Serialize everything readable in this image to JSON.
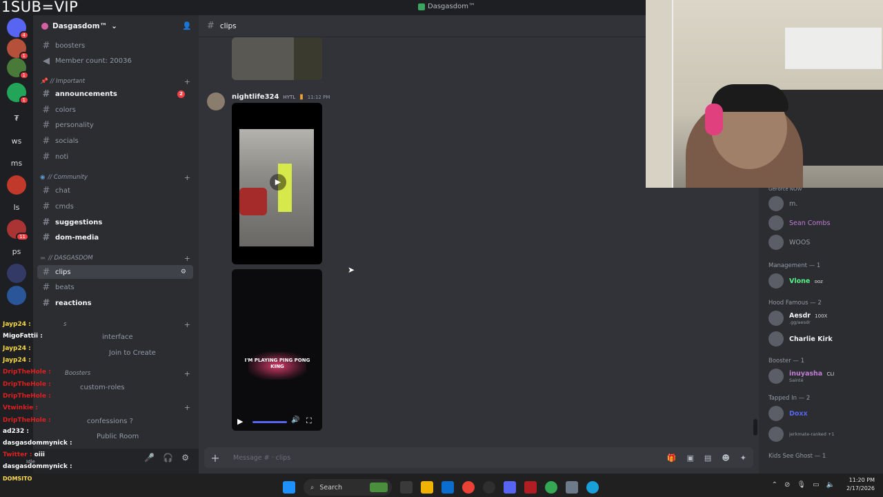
{
  "overlay_banner": "1SUB=VIP",
  "window": {
    "title": "Dasgasdom™"
  },
  "rail": {
    "items": [
      {
        "label": "",
        "badge": "4",
        "color": "#5865f2"
      },
      {
        "label": "",
        "badge": "1",
        "color": "#b5513a"
      },
      {
        "label": "",
        "badge": "1",
        "color": "#4a7a3a"
      },
      {
        "label": "",
        "badge": "1",
        "color": "#23a559"
      },
      {
        "label": "₮",
        "badge": "",
        "color": "#1e1f22"
      },
      {
        "label": "ws",
        "badge": "",
        "color": "#1e1f22"
      },
      {
        "label": "ms",
        "badge": "",
        "color": "#1e1f22"
      },
      {
        "label": "",
        "badge": "",
        "color": "#c0392b"
      },
      {
        "label": "ls",
        "badge": "",
        "color": "#1e1f22"
      },
      {
        "label": "",
        "badge": "11",
        "color": "#a33"
      },
      {
        "label": "ps",
        "badge": "",
        "color": "#1e1f22"
      },
      {
        "label": "",
        "badge": "",
        "color": "#333a66"
      },
      {
        "label": "",
        "badge": "",
        "color": "#2a5599"
      }
    ]
  },
  "guild": {
    "name": "Dasgasdom™"
  },
  "channels": {
    "top": [
      {
        "name": "boosters",
        "icon": "#"
      },
      {
        "name": "Member count: 20036",
        "icon": "🔊"
      }
    ],
    "cat_important": "// Important",
    "important": [
      {
        "name": "announcements",
        "bold": true,
        "badge": "2"
      },
      {
        "name": "colors"
      },
      {
        "name": "personality"
      },
      {
        "name": "socials"
      },
      {
        "name": "noti"
      }
    ],
    "cat_community": "// Community",
    "community": [
      {
        "name": "chat"
      },
      {
        "name": "cmds"
      },
      {
        "name": "suggestions",
        "bold": true
      },
      {
        "name": "dom-media",
        "bold": true
      }
    ],
    "cat_dasgasdom": "// DASGASDOM",
    "dasgasdom": [
      {
        "name": "clips",
        "active": true
      },
      {
        "name": "beats"
      },
      {
        "name": "reactions",
        "bold": true
      }
    ],
    "cat_voice": "s",
    "voice": [
      "interface",
      "Join to Create"
    ],
    "cat_boosters": "Boosters",
    "boosters": [
      "custom-roles"
    ],
    "other": [
      "confessions ?",
      "Public Room"
    ]
  },
  "overlay_chat": [
    {
      "user": "Jayp24",
      "msg": "",
      "color": "#f5d742"
    },
    {
      "user": "MigoFattii",
      "msg": "",
      "color": "#ffffff"
    },
    {
      "user": "Jayp24",
      "msg": "",
      "color": "#f5d742"
    },
    {
      "user": "Jayp24",
      "msg": "",
      "color": "#f5d742"
    },
    {
      "user": "DripTheHole",
      "msg": "",
      "color": "#e02020"
    },
    {
      "user": "DripTheHole",
      "msg": "",
      "color": "#e02020"
    },
    {
      "user": "DripTheHole",
      "msg": "",
      "color": "#e02020"
    },
    {
      "user": "Vtwinkie",
      "msg": "",
      "color": "#e02020"
    },
    {
      "user": "DripTheHole",
      "msg": "",
      "color": "#e02020"
    },
    {
      "user": "ad232",
      "msg": "",
      "color": "#ffffff"
    },
    {
      "user": "dasgasdommynick",
      "msg": "",
      "color": "#ffffff"
    },
    {
      "user": "Twitter",
      "msg": "oiii",
      "color": "#e02020"
    },
    {
      "user": "dasgasdommynick",
      "msg": "",
      "color": "#ffffff"
    }
  ],
  "user_panel": {
    "status": "Idle"
  },
  "channel_header": {
    "name": "clips"
  },
  "message": {
    "author": "nightlife324",
    "role": "HYTL",
    "time": "11:12 PM"
  },
  "video": {
    "caption": "I'M PLAYING PING PONG KING"
  },
  "composer": {
    "placeholder": "Message # · clips"
  },
  "members": {
    "items_top": [
      {
        "name": "GeForce NOW",
        "color": "#949ba4"
      },
      {
        "name": "m.",
        "color": "#949ba4"
      },
      {
        "name": "Sean Combs",
        "color": "#c27cd6"
      },
      {
        "name": "WOOS",
        "color": "#949ba4"
      }
    ],
    "groups": [
      {
        "title": "Management — 1",
        "members": [
          {
            "name": "Vlone",
            "tag": "ooz",
            "color": "#57f287"
          }
        ]
      },
      {
        "title": "Hood Famous — 2",
        "members": [
          {
            "name": "Aesdr",
            "tag": "100X",
            "sub": ".gg/aesdr",
            "color": "#f2f3f5"
          },
          {
            "name": "Charlie Kirk",
            "tag": "",
            "color": "#f2f3f5"
          }
        ]
      },
      {
        "title": "Booster — 1",
        "members": [
          {
            "name": "inuyasha",
            "tag": "CLI",
            "sub": "Sainté",
            "color": "#c27cd6"
          }
        ]
      },
      {
        "title": "Tapped In — 2",
        "members": [
          {
            "name": "Doxx",
            "tag": "",
            "color": "#5865f2"
          },
          {
            "name": "",
            "tag": "",
            "sub": "jerkmate-ranked +1",
            "color": "#949ba4"
          }
        ]
      },
      {
        "title": "Kids See Ghost — 1",
        "members": []
      }
    ]
  },
  "taskbar": {
    "search": "Search",
    "time": "11:20 PM",
    "date": "2/17/2026"
  },
  "overlay_footer": "DOMSITO"
}
